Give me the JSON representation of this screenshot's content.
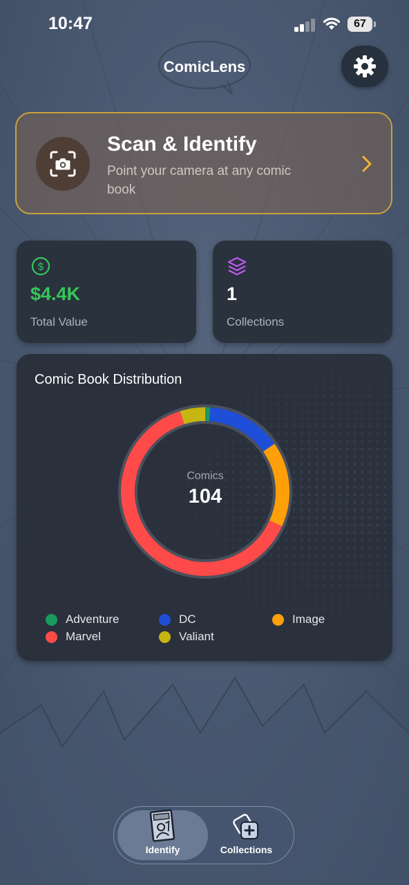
{
  "status_bar": {
    "time": "10:47",
    "battery": "67"
  },
  "header": {
    "title": "ComicLens",
    "settings_icon": "gear-icon"
  },
  "scan_card": {
    "title": "Scan & Identify",
    "subtitle": "Point your camera at any comic book",
    "icon": "camera-scan-icon"
  },
  "stats": {
    "total_value": {
      "value": "$4.4K",
      "label": "Total Value",
      "icon": "dollar-icon",
      "color": "#34c759"
    },
    "collections": {
      "value": "1",
      "label": "Collections",
      "icon": "layers-icon",
      "color": "#bf5af2"
    }
  },
  "distribution": {
    "title": "Comic Book Distribution",
    "center_label": "Comics",
    "total": "104",
    "legend": [
      {
        "name": "Adventure",
        "color": "#1a9a5c"
      },
      {
        "name": "DC",
        "color": "#1f4fd8"
      },
      {
        "name": "Image",
        "color": "#ff9f0a"
      },
      {
        "name": "Marvel",
        "color": "#ff4a4a"
      },
      {
        "name": "Valiant",
        "color": "#c7b512"
      }
    ]
  },
  "chart_data": {
    "type": "pie",
    "categories": [
      "Adventure",
      "DC",
      "Image",
      "Marvel",
      "Valiant"
    ],
    "values": [
      1,
      15,
      17,
      66,
      5
    ],
    "colors": [
      "#1a9a5c",
      "#1f4fd8",
      "#ff9f0a",
      "#ff4a4a",
      "#c7b512"
    ],
    "title": "Comic Book Distribution"
  },
  "tab_bar": {
    "tabs": [
      {
        "label": "Identify",
        "icon": "comic-book-icon",
        "active": true
      },
      {
        "label": "Collections",
        "icon": "collections-add-icon",
        "active": false
      }
    ]
  }
}
